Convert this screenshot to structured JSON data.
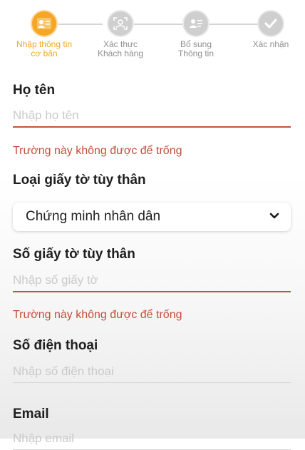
{
  "stepper": {
    "steps": [
      {
        "label": "Nhập thông tin\ncơ bản",
        "icon": "id-card-icon",
        "active": true
      },
      {
        "label": "Xác thực\nKhách hàng",
        "icon": "face-scan-icon",
        "active": false
      },
      {
        "label": "Bổ sung\nThông tin",
        "icon": "person-card-icon",
        "active": false
      },
      {
        "label": "Xác nhận",
        "icon": "checkmark-icon",
        "active": false
      }
    ],
    "active_color": "#f5a623",
    "inactive_color": "#cfcfcf"
  },
  "form": {
    "full_name": {
      "label": "Họ tên",
      "placeholder": "Nhập họ tên",
      "value": "",
      "error": "Trường này không được để trống"
    },
    "id_type": {
      "label": "Loại giấy tờ tùy thân",
      "selected": "Chứng minh nhân dân"
    },
    "id_number": {
      "label": "Số giấy tờ tùy thân",
      "placeholder": "Nhập số giấy tờ",
      "value": "",
      "error": "Trường này không được để trống"
    },
    "phone": {
      "label": "Số điện thoại",
      "placeholder": "Nhập số điện thoại",
      "value": ""
    },
    "email": {
      "label": "Email",
      "placeholder": "Nhập email",
      "value": ""
    }
  },
  "colors": {
    "error": "#c0503b",
    "error_underline": "#c9503c"
  }
}
